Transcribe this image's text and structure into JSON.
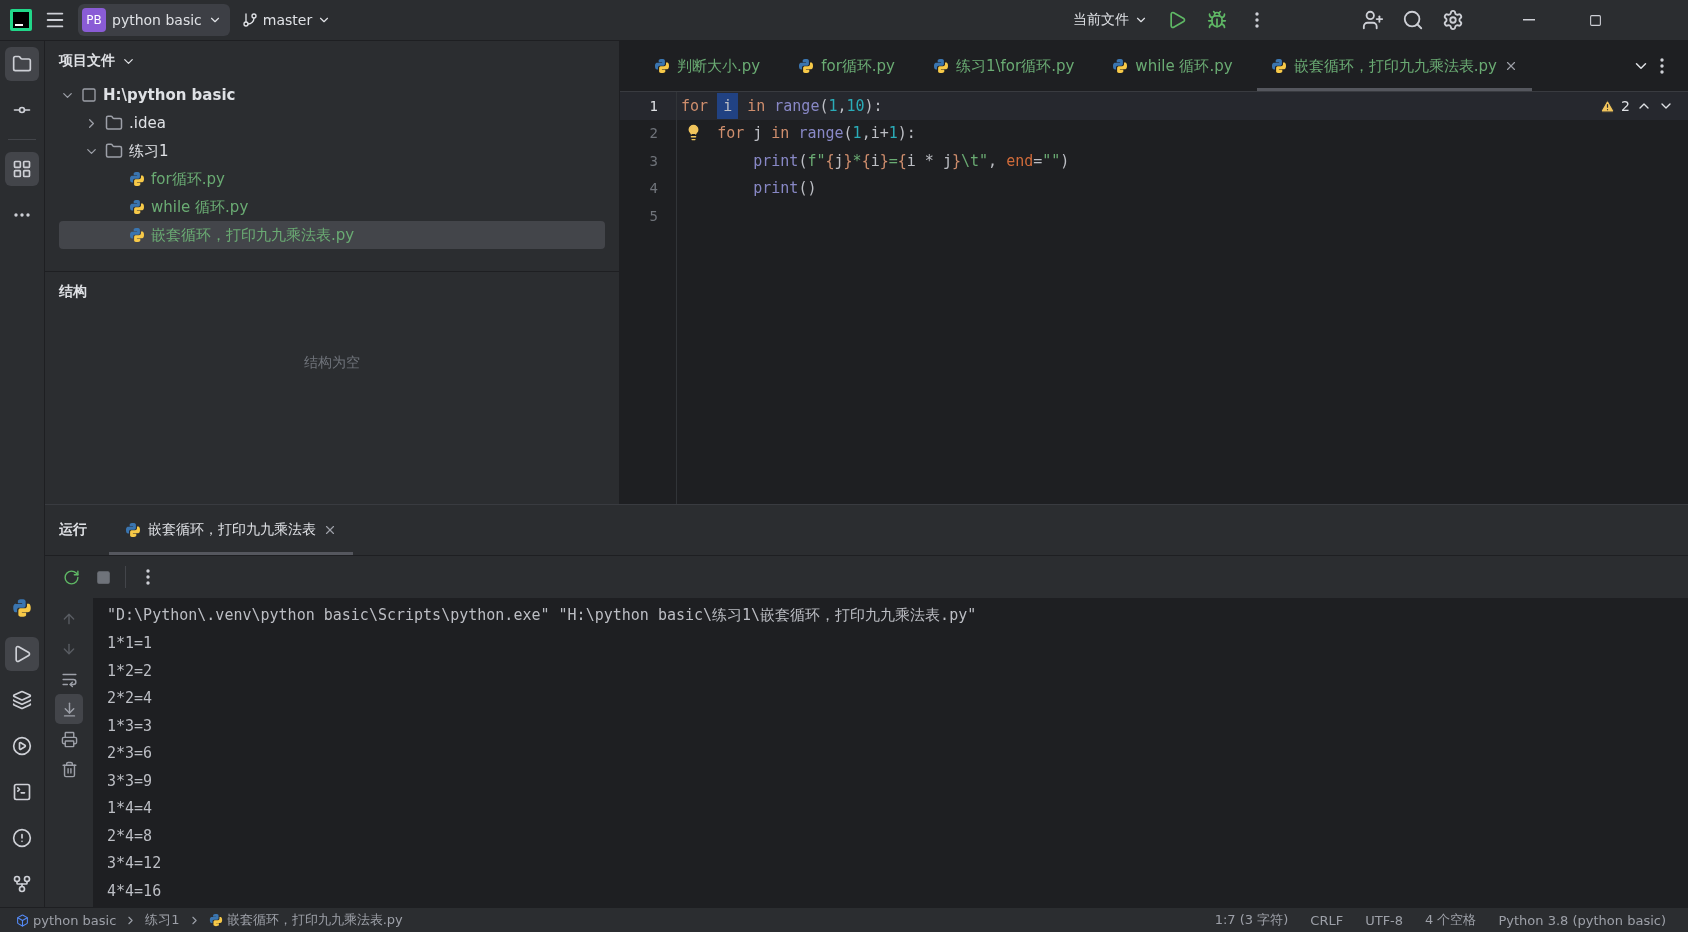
{
  "title_bar": {
    "project_badge": "PB",
    "project": "python basic",
    "branch": "master",
    "run_config": "当前文件"
  },
  "tool_strip": {
    "top": [
      {
        "kind": "folder",
        "selected": true
      },
      {
        "kind": "commit",
        "selected": false
      },
      {
        "kind": "structure",
        "selected": true
      },
      {
        "kind": "more",
        "selected": false
      }
    ],
    "bottom": [
      {
        "kind": "python",
        "selected": false
      },
      {
        "kind": "run",
        "selected": true
      },
      {
        "kind": "layers",
        "selected": false
      },
      {
        "kind": "services",
        "selected": false
      },
      {
        "kind": "terminal",
        "selected": false
      },
      {
        "kind": "problems",
        "selected": false
      },
      {
        "kind": "git",
        "selected": false
      }
    ]
  },
  "project_panel": {
    "title": "项目文件",
    "tree": [
      {
        "label": "H:\\python basic",
        "kind": "root",
        "expanded": true,
        "children": [
          {
            "label": ".idea",
            "kind": "folder",
            "expanded": false
          },
          {
            "label": "练习1",
            "kind": "folder",
            "expanded": true,
            "children": [
              {
                "label": "for循环.py",
                "kind": "python",
                "selected": false
              },
              {
                "label": "while 循环.py",
                "kind": "python",
                "selected": false
              },
              {
                "label": "嵌套循环，打印九九乘法表.py",
                "kind": "python",
                "selected": true
              }
            ]
          }
        ]
      }
    ]
  },
  "structure_panel": {
    "title": "结构",
    "empty_text": "结构为空"
  },
  "editor": {
    "tabs": [
      {
        "label": "判断大小.py",
        "selected": false
      },
      {
        "label": "for循环.py",
        "selected": false
      },
      {
        "label": "练习1\\for循环.py",
        "selected": false
      },
      {
        "label": "while 循环.py",
        "selected": false
      },
      {
        "label": "嵌套循环，打印九九乘法表.py",
        "selected": true
      }
    ],
    "warnings": "2",
    "lines": [
      {
        "number": "1",
        "current": true,
        "tokens": [
          {
            "text": "for ",
            "kind": "kw"
          },
          {
            "text": "i",
            "kind": "selected"
          },
          {
            "text": " in ",
            "kind": "kw"
          },
          {
            "text": "range",
            "kind": "fn"
          },
          {
            "text": "(",
            "kind": "id"
          },
          {
            "text": "1",
            "kind": "num"
          },
          {
            "text": ",",
            "kind": "id"
          },
          {
            "text": "10",
            "kind": "num"
          },
          {
            "text": "):",
            "kind": "id"
          }
        ]
      },
      {
        "number": "2",
        "current": false,
        "tokens": [
          {
            "text": "    for ",
            "kind": "kw"
          },
          {
            "text": "j ",
            "kind": "id"
          },
          {
            "text": "in ",
            "kind": "kw"
          },
          {
            "text": "range",
            "kind": "fn"
          },
          {
            "text": "(",
            "kind": "id"
          },
          {
            "text": "1",
            "kind": "num"
          },
          {
            "text": ",i+",
            "kind": "id"
          },
          {
            "text": "1",
            "kind": "num"
          },
          {
            "text": "):",
            "kind": "id"
          }
        ]
      },
      {
        "number": "3",
        "current": false,
        "tokens": [
          {
            "text": "        print",
            "kind": "fn"
          },
          {
            "text": "(",
            "kind": "id"
          },
          {
            "text": "f\"",
            "kind": "str"
          },
          {
            "text": "{",
            "kind": "kw"
          },
          {
            "text": "j",
            "kind": "id"
          },
          {
            "text": "}",
            "kind": "kw"
          },
          {
            "text": "*",
            "kind": "str"
          },
          {
            "text": "{",
            "kind": "kw"
          },
          {
            "text": "i",
            "kind": "id"
          },
          {
            "text": "}",
            "kind": "kw"
          },
          {
            "text": "=",
            "kind": "str"
          },
          {
            "text": "{",
            "kind": "kw"
          },
          {
            "text": "i * j",
            "kind": "id"
          },
          {
            "text": "}",
            "kind": "kw"
          },
          {
            "text": "\\t\"",
            "kind": "str"
          },
          {
            "text": ", ",
            "kind": "id"
          },
          {
            "text": "end",
            "kind": "param"
          },
          {
            "text": "=",
            "kind": "id"
          },
          {
            "text": "\"\"",
            "kind": "str"
          },
          {
            "text": ")",
            "kind": "id"
          }
        ]
      },
      {
        "number": "4",
        "current": false,
        "tokens": [
          {
            "text": "        print",
            "kind": "fn"
          },
          {
            "text": "()",
            "kind": "id"
          }
        ]
      },
      {
        "number": "5",
        "current": false
      }
    ]
  },
  "run_panel": {
    "title": "运行",
    "tabs": [
      {
        "label": "嵌套循环，打印九九乘法表",
        "selected": true
      }
    ],
    "output": [
      "\"D:\\Python\\.venv\\python basic\\Scripts\\python.exe\" \"H:\\python basic\\练习1\\嵌套循环，打印九九乘法表.py\"",
      "1*1=1",
      "1*2=2",
      "2*2=4",
      "1*3=3",
      "2*3=6",
      "3*3=9",
      "1*4=4",
      "2*4=8",
      "3*4=12",
      "4*4=16"
    ]
  },
  "status_bar": {
    "breadcrumbs": [
      {
        "label": "python basic",
        "kind": "module"
      },
      {
        "label": "练习1",
        "kind": "folder"
      },
      {
        "label": "嵌套循环，打印九九乘法表.py",
        "kind": "python"
      }
    ],
    "items": [
      "1:7 (3 字符)",
      "CRLF",
      "UTF-8",
      "4 个空格",
      "Python 3.8 (python basic)"
    ]
  }
}
